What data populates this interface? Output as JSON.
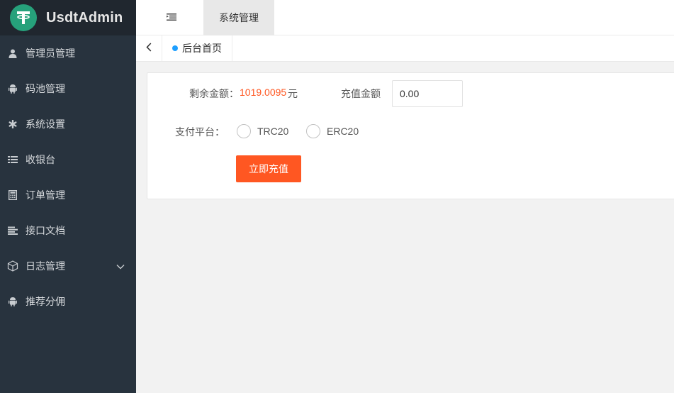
{
  "app": {
    "title": "UsdtAdmin"
  },
  "sidebar": {
    "items": [
      {
        "label": "管理员管理",
        "icon": "user-icon"
      },
      {
        "label": "码池管理",
        "icon": "android-icon"
      },
      {
        "label": "系统设置",
        "icon": "asterisk-icon"
      },
      {
        "label": "收银台",
        "icon": "list-icon"
      },
      {
        "label": "订单管理",
        "icon": "calculator-icon"
      },
      {
        "label": "接口文档",
        "icon": "align-left-icon"
      },
      {
        "label": "日志管理",
        "icon": "cube-icon",
        "has_submenu": true
      },
      {
        "label": "推荐分佣",
        "icon": "android-icon"
      }
    ]
  },
  "header": {
    "active_tab": "系统管理"
  },
  "tabs": {
    "home": "后台首页"
  },
  "form": {
    "balance_label": "剩余金额：",
    "balance_value": "1019.0095",
    "balance_unit": "元",
    "amount_label": "充值金额",
    "amount_value": "0.00",
    "platform_label": "支付平台：",
    "platforms": [
      "TRC20",
      "ERC20"
    ],
    "submit_label": "立即充值"
  },
  "colors": {
    "sidebar_bg": "#28333e",
    "logo_bg": "#20272f",
    "accent": "#ff5722",
    "brand": "#26a17b",
    "tab_dot": "#1e9fff"
  }
}
